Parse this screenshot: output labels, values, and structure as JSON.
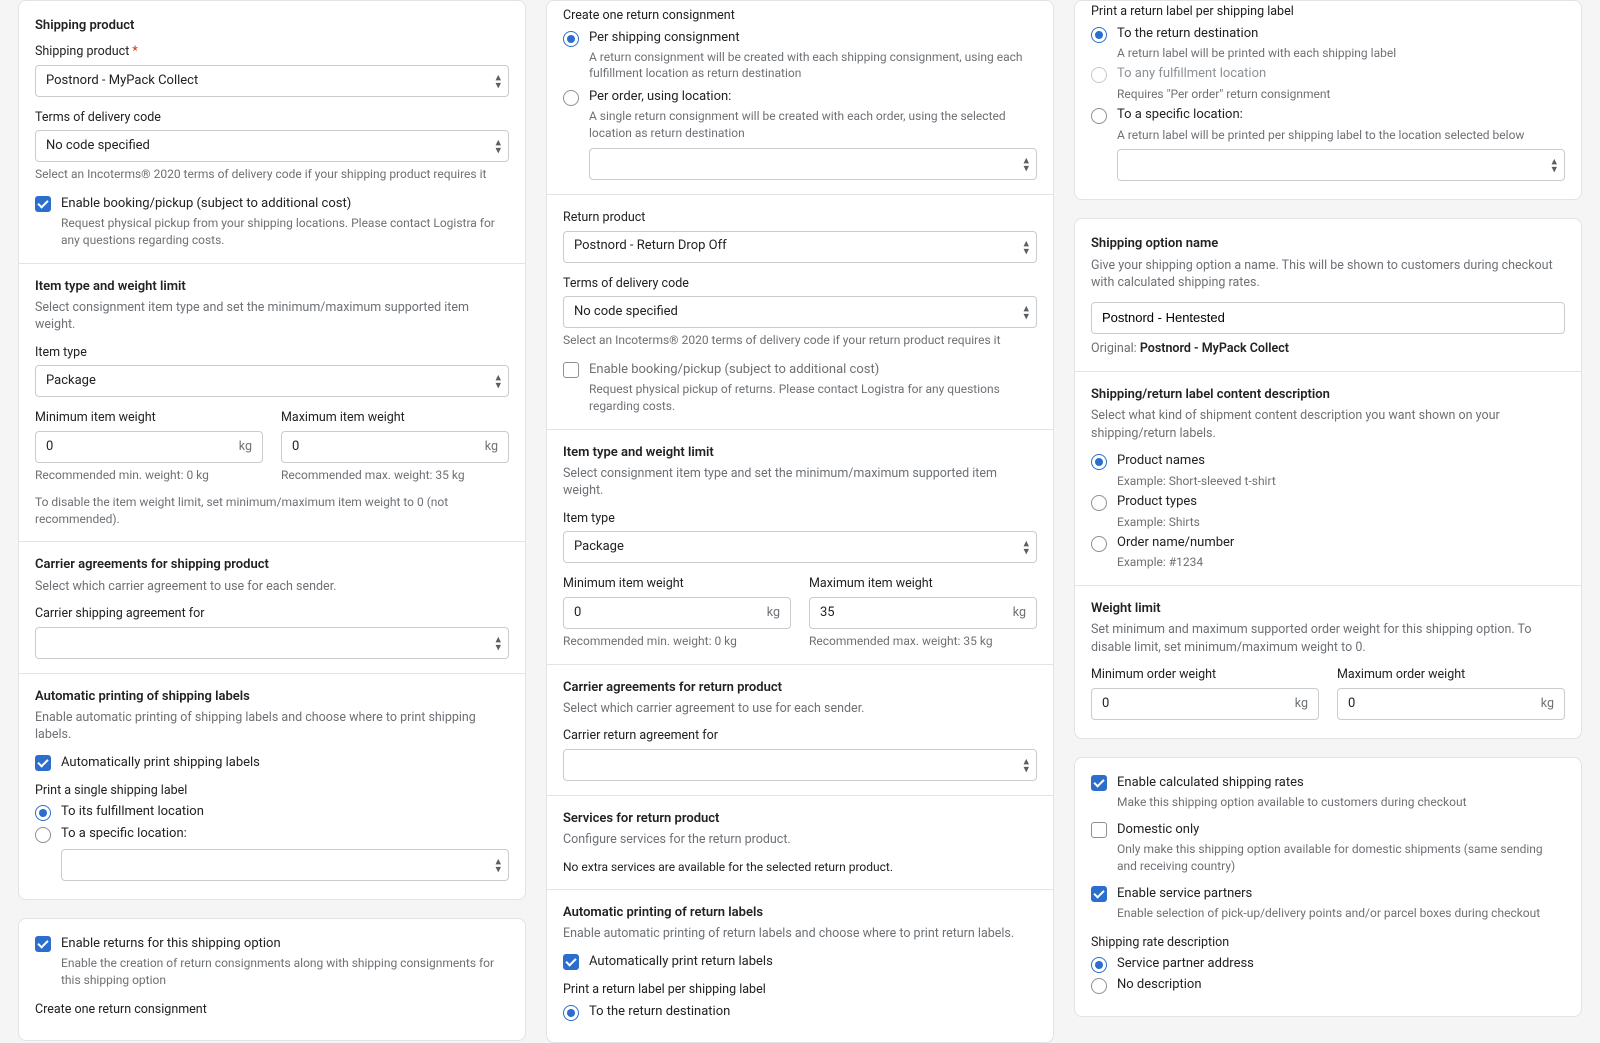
{
  "col1": {
    "shipping_product": {
      "title": "Shipping product",
      "product_label": "Shipping product",
      "product_value": "Postnord - MyPack Collect",
      "terms_label": "Terms of delivery code",
      "terms_value": "No code specified",
      "terms_help": "Select an Incoterms® 2020 terms of delivery code if your shipping product requires it",
      "booking_label": "Enable booking/pickup (subject to additional cost)",
      "booking_desc": "Request physical pickup from your shipping locations. Please contact Logistra for any questions regarding costs."
    },
    "item_type": {
      "title": "Item type and weight limit",
      "desc": "Select consignment item type and set the minimum/maximum supported item weight.",
      "type_label": "Item type",
      "type_value": "Package",
      "min_label": "Minimum item weight",
      "min_value": "0",
      "max_label": "Maximum item weight",
      "max_value": "0",
      "unit": "kg",
      "min_help": "Recommended min. weight: 0 kg",
      "max_help": "Recommended max. weight: 35 kg",
      "disable_help": "To disable the item weight limit, set minimum/maximum item weight to 0 (not recommended)."
    },
    "carrier": {
      "title": "Carrier agreements for shipping product",
      "desc": "Select which carrier agreement to use for each sender.",
      "label": "Carrier shipping agreement for"
    },
    "auto_print": {
      "title": "Automatic printing of shipping labels",
      "desc": "Enable automatic printing of shipping labels and choose where to print shipping labels.",
      "check_label": "Automatically print shipping labels",
      "single_label": "Print a single shipping label",
      "r1": "To its fulfillment location",
      "r2": "To a specific location:"
    },
    "returns": {
      "check_label": "Enable returns for this shipping option",
      "check_desc": "Enable the creation of return consignments along with shipping consignments for this shipping option",
      "create_label": "Create one return consignment"
    }
  },
  "col2": {
    "create_return": {
      "title": "Create one return consignment",
      "r1": "Per shipping consignment",
      "r1_desc": "A return consignment will be created with each shipping consignment, using each fulfillment location as return destination",
      "r2": "Per order, using location:",
      "r2_desc": "A single return consignment will be created with each order, using the selected location as return destination"
    },
    "return_product": {
      "label": "Return product",
      "value": "Postnord - Return Drop Off",
      "terms_label": "Terms of delivery code",
      "terms_value": "No code specified",
      "terms_help": "Select an Incoterms® 2020 terms of delivery code if your return product requires it",
      "booking_label": "Enable booking/pickup (subject to additional cost)",
      "booking_desc": "Request physical pickup of returns. Please contact Logistra for any questions regarding costs."
    },
    "item_type": {
      "title": "Item type and weight limit",
      "desc": "Select consignment item type and set the minimum/maximum supported item weight.",
      "type_label": "Item type",
      "type_value": "Package",
      "min_label": "Minimum item weight",
      "min_value": "0",
      "max_label": "Maximum item weight",
      "max_value": "35",
      "unit": "kg",
      "min_help": "Recommended min. weight: 0 kg",
      "max_help": "Recommended max. weight: 35 kg"
    },
    "carrier": {
      "title": "Carrier agreements for return product",
      "desc": "Select which carrier agreement to use for each sender.",
      "label": "Carrier return agreement for"
    },
    "services": {
      "title": "Services for return product",
      "desc": "Configure services for the return product.",
      "none": "No extra services are available for the selected return product."
    },
    "auto_print": {
      "title": "Automatic printing of return labels",
      "desc": "Enable automatic printing of return labels and choose where to print return labels.",
      "check_label": "Automatically print return labels",
      "per_label": "Print a return label per shipping label",
      "r1": "To the return destination"
    }
  },
  "col3": {
    "print_label": {
      "title": "Print a return label per shipping label",
      "r1": "To the return destination",
      "r1_desc": "A return label will be printed with each shipping label",
      "r2": "To any fulfillment location",
      "r2_desc": "Requires \"Per order\" return consignment",
      "r3": "To a specific location:",
      "r3_desc": "A return label will be printed per shipping label to the location selected below"
    },
    "option_name": {
      "title": "Shipping option name",
      "desc": "Give your shipping option a name. This will be shown to customers during checkout with calculated shipping rates.",
      "value": "Postnord - Hentested",
      "original_prefix": "Original: ",
      "original": "Postnord - MyPack Collect"
    },
    "content_desc": {
      "title": "Shipping/return label content description",
      "desc": "Select what kind of shipment content description you want shown on your shipping/return labels.",
      "r1": "Product names",
      "r1_ex": "Example: Short-sleeved t-shirt",
      "r2": "Product types",
      "r2_ex": "Example: Shirts",
      "r3": "Order name/number",
      "r3_ex": "Example: #1234"
    },
    "weight_limit": {
      "title": "Weight limit",
      "desc": "Set minimum and maximum supported order weight for this shipping option. To disable limit, set minimum/maximum weight to 0.",
      "min_label": "Minimum order weight",
      "min_value": "0",
      "max_label": "Maximum order weight",
      "max_value": "0",
      "unit": "kg"
    },
    "opts": {
      "calc_label": "Enable calculated shipping rates",
      "calc_desc": "Make this shipping option available to customers during checkout",
      "dom_label": "Domestic only",
      "dom_desc": "Only make this shipping option available for domestic shipments (same sending and receiving country)",
      "sp_label": "Enable service partners",
      "sp_desc": "Enable selection of pick-up/delivery points and/or parcel boxes during checkout",
      "rate_title": "Shipping rate description",
      "r1": "Service partner address",
      "r2": "No description"
    }
  }
}
